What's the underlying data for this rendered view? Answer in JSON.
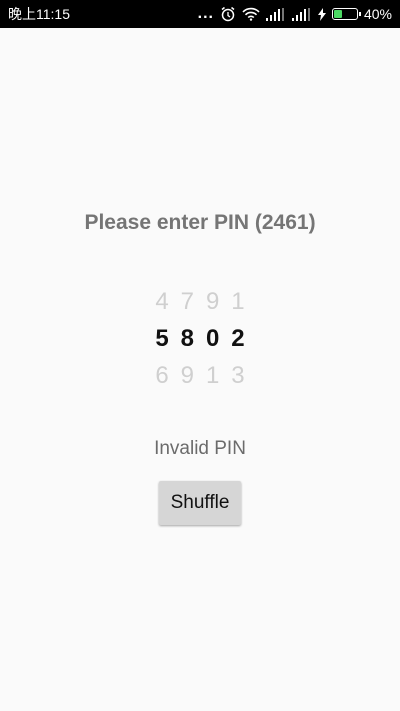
{
  "statusbar": {
    "time": "晚上11:15",
    "dots": "...",
    "alarm_icon": "alarm-clock-icon",
    "wifi_icon": "wifi-icon",
    "signal_icon_1": "cell-signal-icon",
    "signal_icon_2": "cell-signal-icon",
    "charging_icon": "lightning-bolt-icon",
    "battery_percent": "40%",
    "battery_level": 0.4,
    "battery_color": "#4cd964"
  },
  "pin_screen": {
    "prompt": "Please enter PIN (2461)",
    "picker": {
      "above": [
        "4",
        "7",
        "9",
        "1"
      ],
      "selected": [
        "5",
        "8",
        "0",
        "2"
      ],
      "below": [
        "6",
        "9",
        "1",
        "3"
      ]
    },
    "status_message": "Invalid PIN",
    "shuffle_label": "Shuffle"
  }
}
